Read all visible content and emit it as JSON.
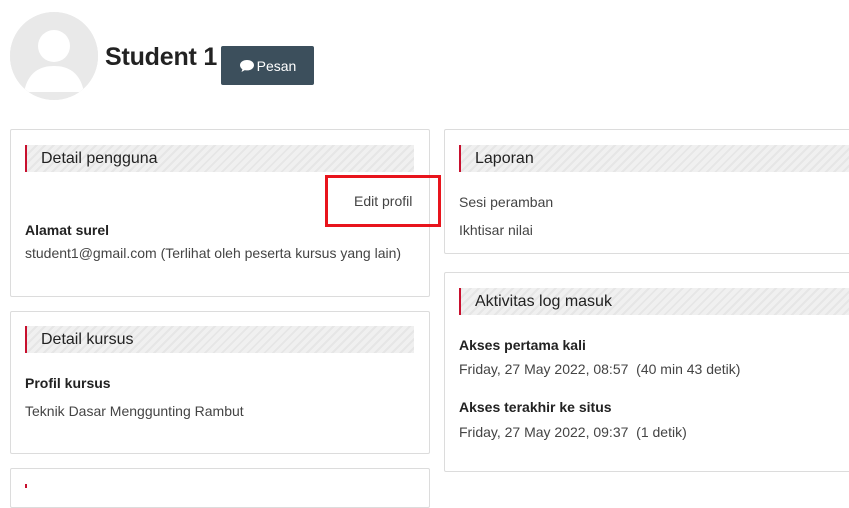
{
  "profile": {
    "name": "Student 1",
    "message_button": "Pesan"
  },
  "user_details": {
    "title": "Detail pengguna",
    "edit_link": "Edit profil",
    "email_label": "Alamat surel",
    "email_value": "student1@gmail.com (Terlihat oleh peserta kursus yang lain)"
  },
  "course_details": {
    "title": "Detail kursus",
    "profile_label": "Profil kursus",
    "course_name": "Teknik Dasar Menggunting Rambut"
  },
  "reports": {
    "title": "Laporan",
    "items": [
      "Sesi peramban",
      "Ikhtisar nilai"
    ]
  },
  "login_activity": {
    "title": "Aktivitas log masuk",
    "first_access_label": "Akses pertama kali",
    "first_access_value": "Friday, 27 May 2022, 08:57  (40 min 43 detik)",
    "last_access_label": "Akses terakhir ke situs",
    "last_access_value": "Friday, 27 May 2022, 09:37  (1 detik)"
  },
  "colors": {
    "accent": "#c8102e",
    "button": "#3c4f5c",
    "highlight": "#e8141c"
  },
  "icons": {
    "avatar": "user-avatar-icon",
    "message": "speech-bubble-icon"
  }
}
